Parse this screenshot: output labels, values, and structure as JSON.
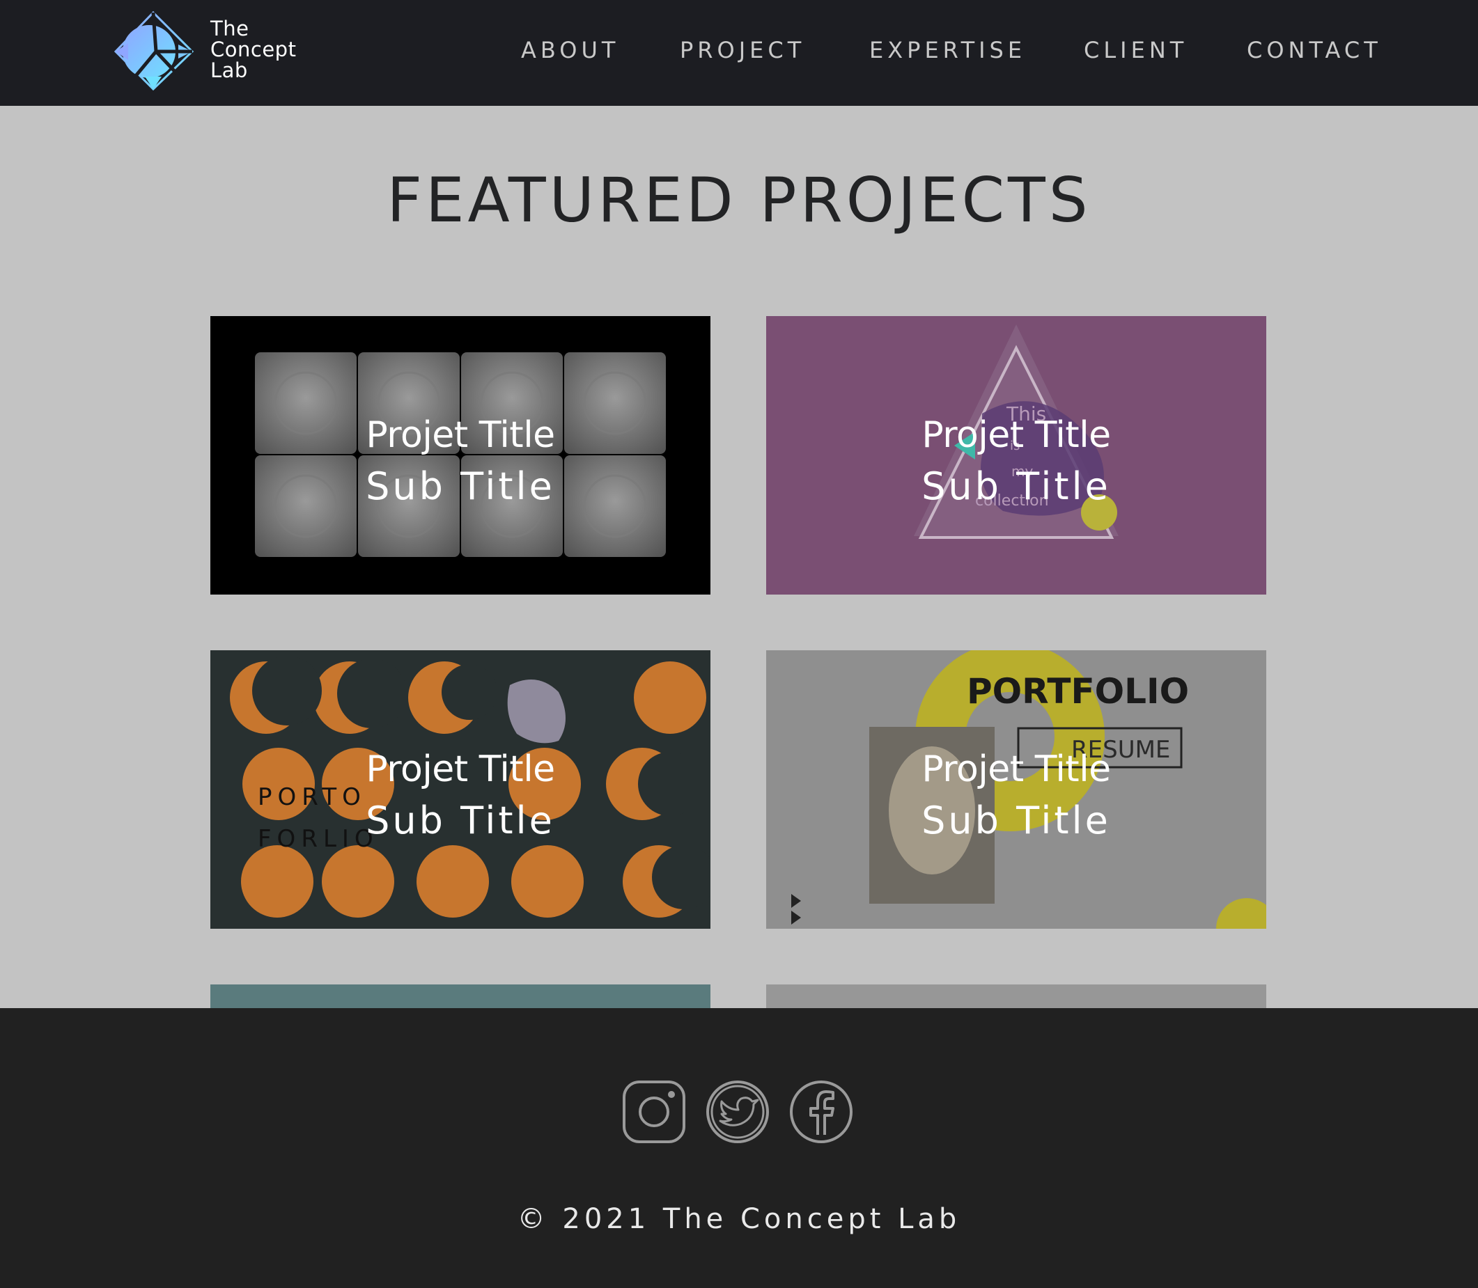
{
  "brand": {
    "line1": "The",
    "line2": "Concept",
    "line3": "Lab",
    "logo_icon": "diamond-logo-icon",
    "logo_gradient": [
      "#8fa6ff",
      "#6fe0ff"
    ]
  },
  "nav": {
    "items": [
      {
        "label": "ABOUT"
      },
      {
        "label": "PROJECT"
      },
      {
        "label": "EXPERTISE"
      },
      {
        "label": "CLIENT"
      },
      {
        "label": "CONTACT"
      }
    ]
  },
  "main": {
    "heading": "FEATURED PROJECTS",
    "projects": [
      {
        "title": "Projet Title",
        "subtitle": "Sub Title",
        "thumb_color": "#000000"
      },
      {
        "title": "Projet Title",
        "subtitle": "Sub Title",
        "thumb_color": "#7a4f73"
      },
      {
        "title": "Projet Title",
        "subtitle": "Sub Title",
        "thumb_color": "#283030"
      },
      {
        "title": "Projet Title",
        "subtitle": "Sub Title",
        "thumb_color": "#8f8f8f"
      }
    ],
    "thumb4_text": {
      "portfolio": "PORTFOLIO",
      "resume": "RESUME"
    },
    "thumb3_text": {
      "line1": "PORTO",
      "line2": "FORLIO"
    },
    "thumb2_text": {
      "line1": "This",
      "line2": "is",
      "line3": "my",
      "line4": "collection"
    }
  },
  "footer": {
    "social_icons": [
      "instagram-icon",
      "twitter-icon",
      "facebook-icon"
    ],
    "copyright": "© 2021 The Concept Lab"
  },
  "colors": {
    "header_bg": "#1c1d22",
    "page_bg": "#c3c3c3",
    "footer_bg": "#212121",
    "nav_text": "#c9c9c9"
  }
}
